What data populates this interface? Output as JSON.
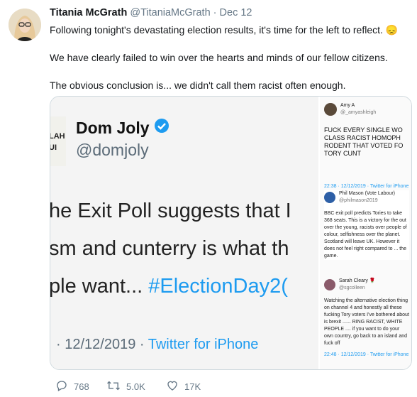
{
  "author": {
    "name": "Titania McGrath",
    "handle": "@TitaniaMcGrath",
    "separator": "·",
    "date": "Dec 12"
  },
  "tweet": {
    "line1": "Following tonight's devastating election results, it's time for the left to reflect. 😞",
    "line2": "We have clearly failed to win over the hearts and minds of our fellow citizens.",
    "line3": "The obvious conclusion is... we didn't call them racist often enough."
  },
  "embedded_main": {
    "name": "Dom Joly",
    "handle": "@domjoly",
    "text_line1": "he Exit Poll suggests that I",
    "text_line2": "sm and cunterry is what th",
    "text_line3_plain": "ple want... ",
    "text_line3_tag": "#ElectionDay2(",
    "timestamp_prefix": "· 12/12/2019 · ",
    "source": "Twitter for iPhone",
    "avatar_fragment_1": "LAH",
    "avatar_fragment_2": "UI"
  },
  "embedded_side": {
    "t1_name": "Amy A",
    "t1_handle": "@_amyashleigh",
    "t1_text": "FUCK EVERY SINGLE WO CLASS RACIST HOMOPH RODENT THAT VOTED FO TORY CUNT",
    "t1_footer": "22:38 · 12/12/2019 · Twitter for iPhone",
    "t2_name": "Phil Mason (Vote Labour)",
    "t2_handle": "@philmason2019",
    "t2_text": "BBC exit poll predicts Tories to take 368 seats. This is a victory for the out over the young, racists over people of colour, selfishness over the planet. Scotland will leave UK. However it does not feel right compared to ... the game.",
    "t3_name": "Sarah Cleary 🌹",
    "t3_handle": "@sgcolleen",
    "t3_text": "Watching the alternative election thing on channel 4 and honestly all these fucking Tory voters I've bothered about is brexit ...... RING RACIST, WHITE PEOPLE .... if you want to do your own country, go back to an island and fuck off",
    "t3_footer": "22:48 · 12/12/2019 · Twitter for iPhone"
  },
  "actions": {
    "replies": "768",
    "retweets": "5.0K",
    "likes": "17K"
  },
  "colors": {
    "link_blue": "#1d9bf0",
    "muted": "#657786",
    "sad_emoji": "#f5b52e"
  }
}
